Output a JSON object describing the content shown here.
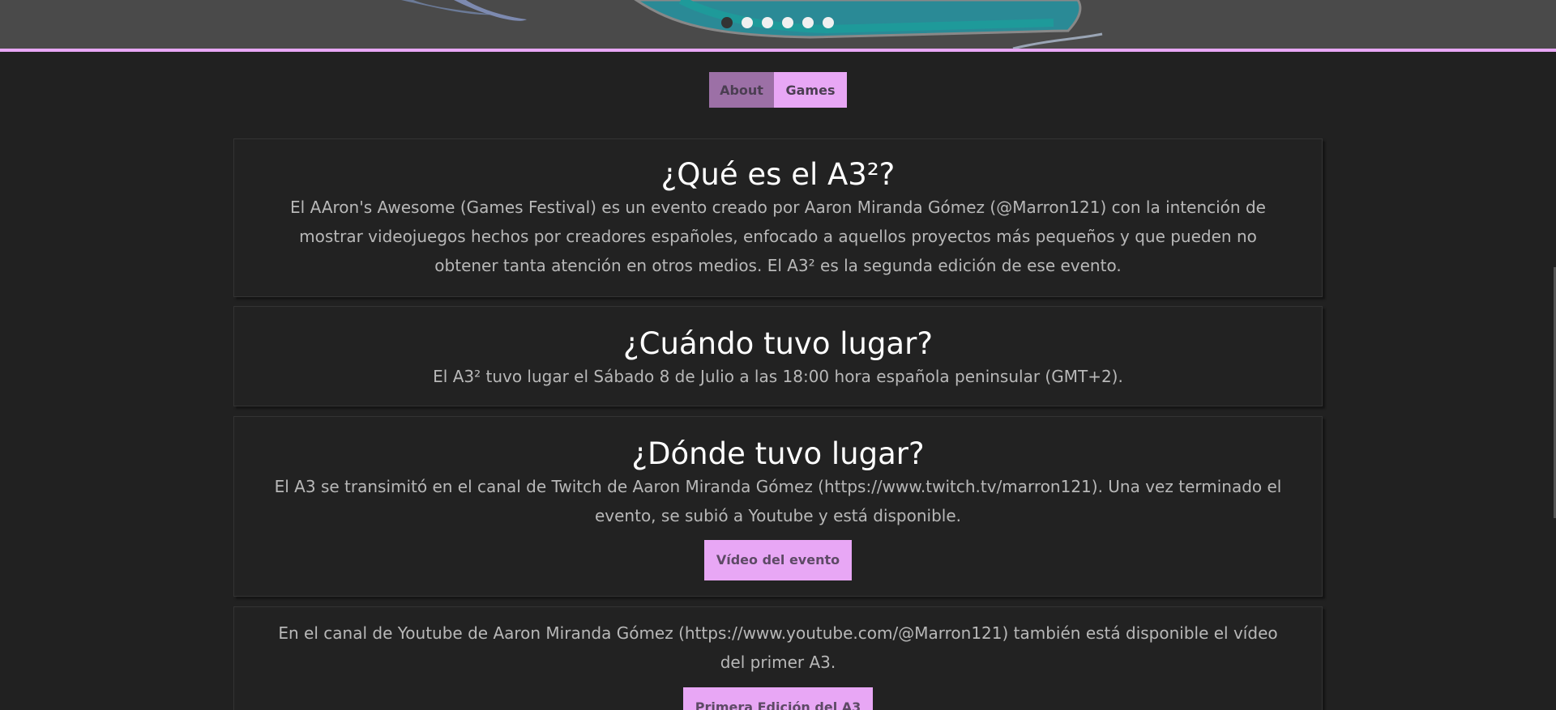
{
  "carousel": {
    "slides": [
      {
        "name": "slide-1",
        "active": true
      },
      {
        "name": "slide-2",
        "active": false
      },
      {
        "name": "slide-3",
        "active": false
      },
      {
        "name": "slide-4",
        "active": false
      },
      {
        "name": "slide-5",
        "active": false
      },
      {
        "name": "slide-6",
        "active": false
      }
    ],
    "accent_color": "#e8a7f5"
  },
  "tabs": {
    "about_label": "About",
    "games_label": "Games"
  },
  "sections": {
    "what": {
      "title": "¿Qué es el A3²?",
      "body": "El AAron's Awesome (Games Festival) es un evento creado por Aaron Miranda Gómez (@Marron121) con la intención de mostrar videojuegos hechos por creadores españoles, enfocado a aquellos proyectos más pequeños y que pueden no obtener tanta atención en otros medios. El A3² es la segunda edición de ese evento."
    },
    "when": {
      "title": "¿Cuándo tuvo lugar?",
      "body": "El A3² tuvo lugar el Sábado 8 de Julio a las 18:00 hora española peninsular (GMT+2)."
    },
    "where": {
      "title": "¿Dónde tuvo lugar?",
      "body": "El A3 se transimitó en el canal de Twitch de Aaron Miranda Gómez (https://www.twitch.tv/marron121). Una vez terminado el evento, se subió a Youtube y está disponible.",
      "button_label": "Vídeo del evento"
    },
    "first_edition": {
      "body": "En el canal de Youtube de Aaron Miranda Gómez (https://www.youtube.com/@Marron121) también está disponible el vídeo del primer A3.",
      "button_label": "Primera Edición del A3"
    }
  }
}
